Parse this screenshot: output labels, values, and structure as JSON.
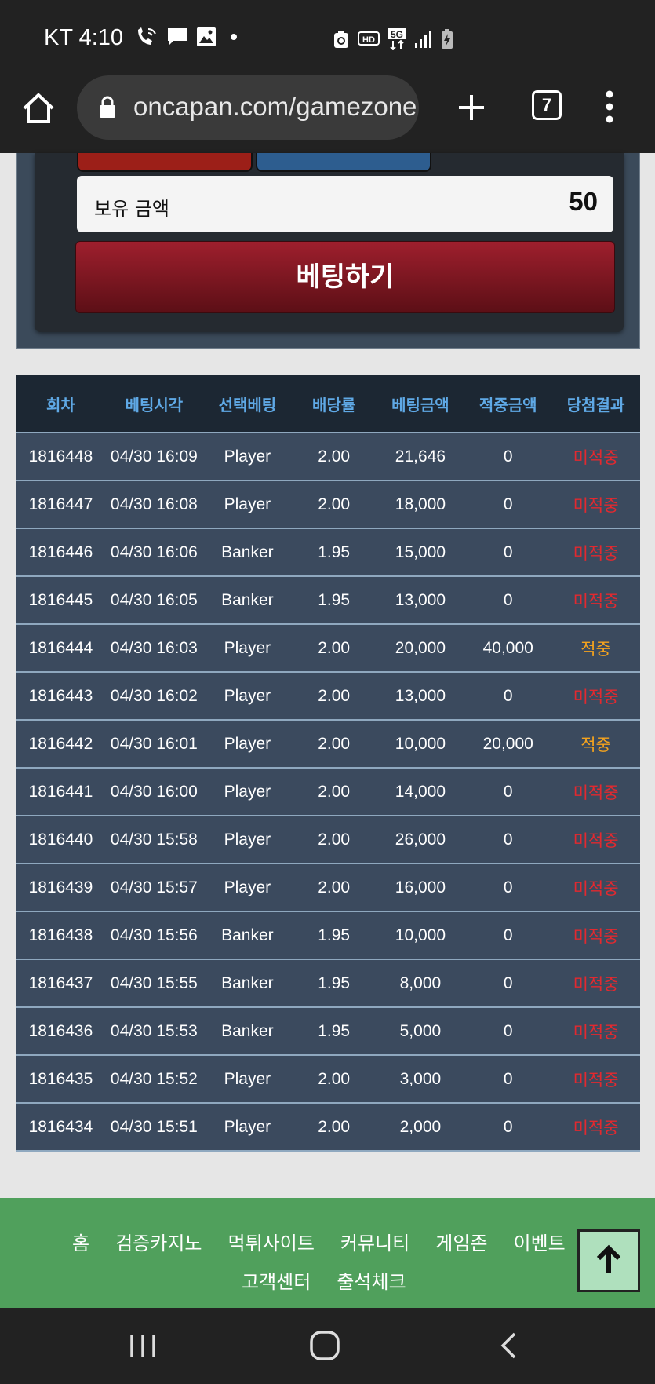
{
  "status_bar": {
    "time": "KT 4:10",
    "icons": [
      "wifi-call-icon",
      "message-icon",
      "gallery-icon",
      "dot-icon",
      "recycle-icon",
      "hd-icon",
      "5g-icon",
      "signal-icon",
      "battery-charging-icon"
    ]
  },
  "browser": {
    "url": "oncapan.com/gamezone",
    "tab_count": "7",
    "icons": [
      "home-icon",
      "lock-icon",
      "plus-icon",
      "tabs-icon",
      "more-vert-icon"
    ]
  },
  "bet_panel": {
    "balance_label": "보유 금액",
    "balance_value": "50",
    "bet_button": "베팅하기"
  },
  "table": {
    "headers": [
      "회차",
      "베팅시각",
      "선택베팅",
      "배당률",
      "베팅금액",
      "적중금액",
      "당첨결과"
    ],
    "rows": [
      {
        "round": "1816448",
        "time": "04/30 16:09",
        "choice": "Player",
        "odds": "2.00",
        "bet": "21,646",
        "win": "0",
        "result": "미적중",
        "hit": false
      },
      {
        "round": "1816447",
        "time": "04/30 16:08",
        "choice": "Player",
        "odds": "2.00",
        "bet": "18,000",
        "win": "0",
        "result": "미적중",
        "hit": false
      },
      {
        "round": "1816446",
        "time": "04/30 16:06",
        "choice": "Banker",
        "odds": "1.95",
        "bet": "15,000",
        "win": "0",
        "result": "미적중",
        "hit": false
      },
      {
        "round": "1816445",
        "time": "04/30 16:05",
        "choice": "Banker",
        "odds": "1.95",
        "bet": "13,000",
        "win": "0",
        "result": "미적중",
        "hit": false
      },
      {
        "round": "1816444",
        "time": "04/30 16:03",
        "choice": "Player",
        "odds": "2.00",
        "bet": "20,000",
        "win": "40,000",
        "result": "적중",
        "hit": true
      },
      {
        "round": "1816443",
        "time": "04/30 16:02",
        "choice": "Player",
        "odds": "2.00",
        "bet": "13,000",
        "win": "0",
        "result": "미적중",
        "hit": false
      },
      {
        "round": "1816442",
        "time": "04/30 16:01",
        "choice": "Player",
        "odds": "2.00",
        "bet": "10,000",
        "win": "20,000",
        "result": "적중",
        "hit": true
      },
      {
        "round": "1816441",
        "time": "04/30 16:00",
        "choice": "Player",
        "odds": "2.00",
        "bet": "14,000",
        "win": "0",
        "result": "미적중",
        "hit": false
      },
      {
        "round": "1816440",
        "time": "04/30 15:58",
        "choice": "Player",
        "odds": "2.00",
        "bet": "26,000",
        "win": "0",
        "result": "미적중",
        "hit": false
      },
      {
        "round": "1816439",
        "time": "04/30 15:57",
        "choice": "Player",
        "odds": "2.00",
        "bet": "16,000",
        "win": "0",
        "result": "미적중",
        "hit": false
      },
      {
        "round": "1816438",
        "time": "04/30 15:56",
        "choice": "Banker",
        "odds": "1.95",
        "bet": "10,000",
        "win": "0",
        "result": "미적중",
        "hit": false
      },
      {
        "round": "1816437",
        "time": "04/30 15:55",
        "choice": "Banker",
        "odds": "1.95",
        "bet": "8,000",
        "win": "0",
        "result": "미적중",
        "hit": false
      },
      {
        "round": "1816436",
        "time": "04/30 15:53",
        "choice": "Banker",
        "odds": "1.95",
        "bet": "5,000",
        "win": "0",
        "result": "미적중",
        "hit": false
      },
      {
        "round": "1816435",
        "time": "04/30 15:52",
        "choice": "Player",
        "odds": "2.00",
        "bet": "3,000",
        "win": "0",
        "result": "미적중",
        "hit": false
      },
      {
        "round": "1816434",
        "time": "04/30 15:51",
        "choice": "Player",
        "odds": "2.00",
        "bet": "2,000",
        "win": "0",
        "result": "미적중",
        "hit": false
      }
    ]
  },
  "footer": {
    "links_row1": [
      "홈",
      "검증카지노",
      "먹튀사이트",
      "커뮤니티",
      "게임존",
      "이벤트"
    ],
    "links_row2": [
      "고객센터",
      "출석체크"
    ],
    "top_button_icon": "arrow-up-icon"
  },
  "nav_bar": {
    "icons": [
      "recents-icon",
      "home-circle-icon",
      "back-icon"
    ]
  },
  "colors": {
    "header_text": "#5fa9e6",
    "row_bg": "#3b4a5e",
    "miss": "#e3292f",
    "hit": "#f4a31e",
    "footer_bg": "#50a05c",
    "bet_button": "#8c1a26"
  }
}
